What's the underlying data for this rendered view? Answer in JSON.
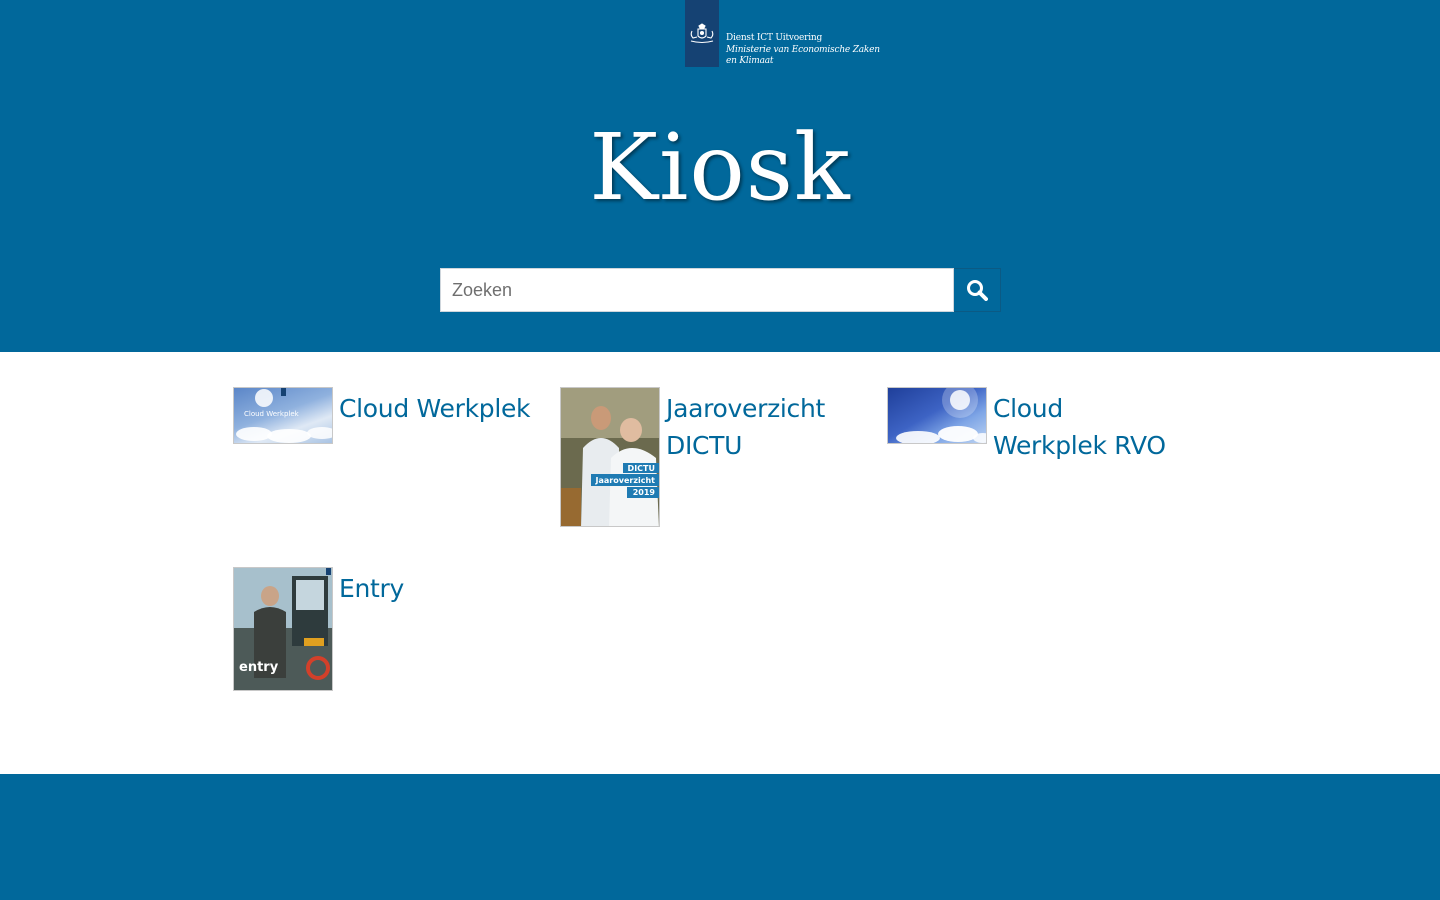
{
  "logo": {
    "line1": "Dienst ICT Uitvoering",
    "line2": "Ministerie van Economische Zaken",
    "line3": "en Klimaat",
    "icon": "coat-of-arms-icon"
  },
  "title": "Kiosk",
  "search": {
    "placeholder": "Zoeken",
    "value": "",
    "button_icon": "search-icon"
  },
  "items": [
    {
      "label": "Cloud Werkplek",
      "thumb_text": "Cloud Werkplek"
    },
    {
      "label": "Jaaroverzicht DICTU",
      "thumb_text": "DICTU Jaaroverzicht 2019"
    },
    {
      "label": "Cloud Werkplek RVO",
      "thumb_text": ""
    },
    {
      "label": "Entry",
      "thumb_text": "entry"
    }
  ],
  "colors": {
    "brand_blue": "#01689b",
    "logo_blue": "#154273",
    "link": "#01689b",
    "background": "#ffffff"
  }
}
